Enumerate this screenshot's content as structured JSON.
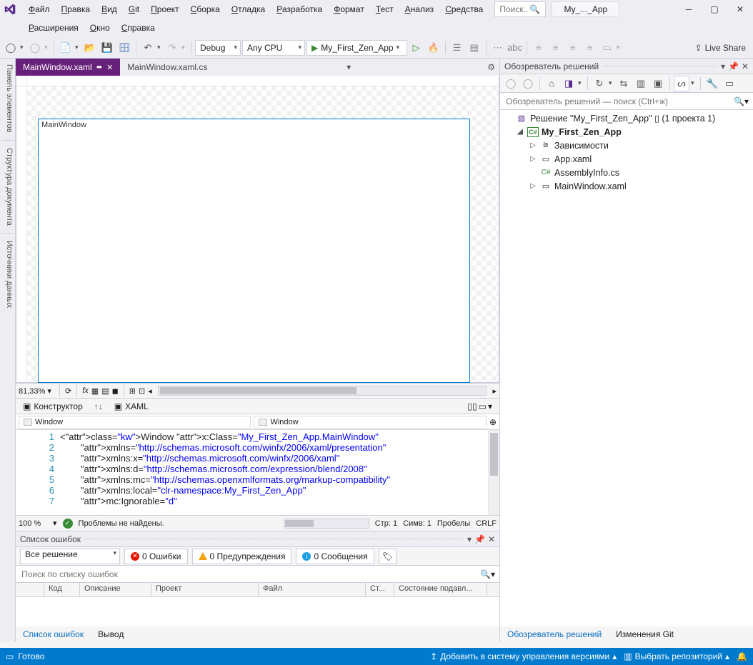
{
  "menu": [
    "Файл",
    "Правка",
    "Вид",
    "Git",
    "Проект",
    "Сборка",
    "Отладка",
    "Разработка",
    "Формат",
    "Тест",
    "Анализ",
    "Средства",
    "Расширения",
    "Окно",
    "Справка"
  ],
  "search_placeholder": "Поиск...",
  "window_title": "My_..._App",
  "toolbar": {
    "config": "Debug",
    "platform": "Any CPU",
    "run_target": "My_First_Zen_App",
    "live_share": "Live Share"
  },
  "side_tabs": [
    "Панель элементов",
    "Структура документа",
    "Источники данных"
  ],
  "editor": {
    "tabs": [
      {
        "name": "MainWindow.xaml",
        "active": true,
        "pinned": true
      },
      {
        "name": "MainWindow.xaml.cs",
        "active": false
      }
    ],
    "designer_window_title": "MainWindow",
    "zoom": "81,33%",
    "design_tab": "Конструктор",
    "xaml_tab": "XAML",
    "crumb_left": "Window",
    "crumb_right": "Window",
    "code": [
      {
        "n": 1,
        "t": "<Window x:Class=\"My_First_Zen_App.MainWindow\""
      },
      {
        "n": 2,
        "t": "        xmlns=\"http://schemas.microsoft.com/winfx/2006/xaml/presentation\""
      },
      {
        "n": 3,
        "t": "        xmlns:x=\"http://schemas.microsoft.com/winfx/2006/xaml\""
      },
      {
        "n": 4,
        "t": "        xmlns:d=\"http://schemas.microsoft.com/expression/blend/2008\""
      },
      {
        "n": 5,
        "t": "        xmlns:mc=\"http://schemas.openxmlformats.org/markup-compatibility\""
      },
      {
        "n": 6,
        "t": "        xmlns:local=\"clr-namespace:My_First_Zen_App\""
      },
      {
        "n": 7,
        "t": "        mc:Ignorable=\"d\""
      }
    ],
    "status": {
      "zoom": "100 %",
      "problems": "Проблемы не найдены.",
      "line": "Стр: 1",
      "col": "Симв: 1",
      "spaces": "Пробелы",
      "le": "CRLF"
    }
  },
  "error_list": {
    "title": "Список ошибок",
    "scope": "Все решение",
    "errors": "0 Ошибки",
    "warnings": "0 Предупреждения",
    "messages": "0 Сообщения",
    "search_placeholder": "Поиск по списку ошибок",
    "cols": [
      "",
      "Код",
      "Описание",
      "Проект",
      "Файл",
      "Ст...",
      "Состояние подавл..."
    ],
    "tabs": {
      "errors": "Список ошибок",
      "output": "Вывод"
    }
  },
  "solution": {
    "title": "Обозреватель решений",
    "search_placeholder": "Обозреватель решений — поиск (Ctrl+ж)",
    "root": "Решение \"My_First_Zen_App\" ▯ (1 проекта 1)",
    "project": "My_First_Zen_App",
    "deps": "Зависимости",
    "app": "App.xaml",
    "asm": "AssemblyInfo.cs",
    "mw": "MainWindow.xaml",
    "bottom_tabs": {
      "se": "Обозреватель решений",
      "git": "Изменения Git"
    }
  },
  "statusbar": {
    "ready": "Готово",
    "source": "Добавить в систему управления версиями",
    "repo": "Выбрать репозиторий"
  }
}
